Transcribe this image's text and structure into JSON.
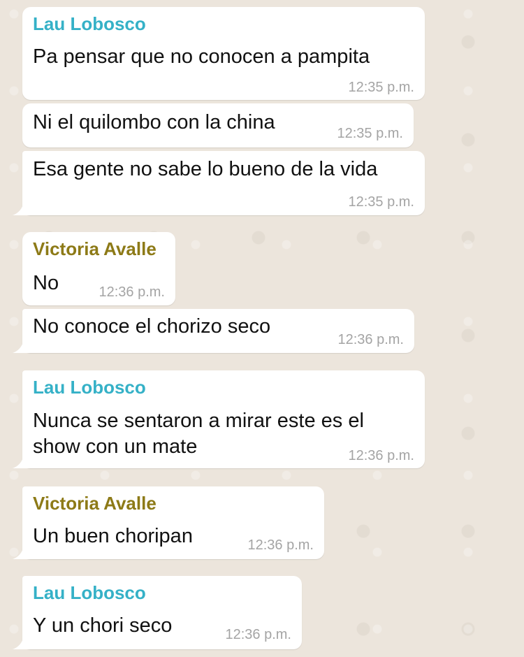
{
  "chat": {
    "messages": [
      {
        "sender": "Lau Lobosco",
        "lines": [
          "Pa pensar que no conocen a pampita"
        ],
        "time": "12:35 p.m."
      },
      {
        "sender": "",
        "lines": [
          "Ni el quilombo con la china"
        ],
        "time": "12:35 p.m."
      },
      {
        "sender": "",
        "lines": [
          "Esa gente no sabe lo bueno de la vida"
        ],
        "time": "12:35 p.m."
      },
      {
        "sender": "Victoria Avalle",
        "lines": [
          "No"
        ],
        "time": "12:36 p.m."
      },
      {
        "sender": "",
        "lines": [
          "No conoce el chorizo seco"
        ],
        "time": "12:36 p.m."
      },
      {
        "sender": "Lau Lobosco",
        "lines": [
          "Nunca se sentaron a mirar este es el",
          "show con un mate"
        ],
        "time": "12:36 p.m."
      },
      {
        "sender": "Victoria Avalle",
        "lines": [
          "Un buen choripan"
        ],
        "time": "12:36 p.m."
      },
      {
        "sender": "Lau Lobosco",
        "lines": [
          "Y un chori seco"
        ],
        "time": "12:36 p.m."
      }
    ]
  },
  "colors": {
    "wallpaper": "#ece5dc",
    "bubble": "#ffffff",
    "lau_name": "#35b1c7",
    "victoria_name": "#8d7a17",
    "timestamp": "#a4a4a4",
    "message_text": "#111111"
  }
}
